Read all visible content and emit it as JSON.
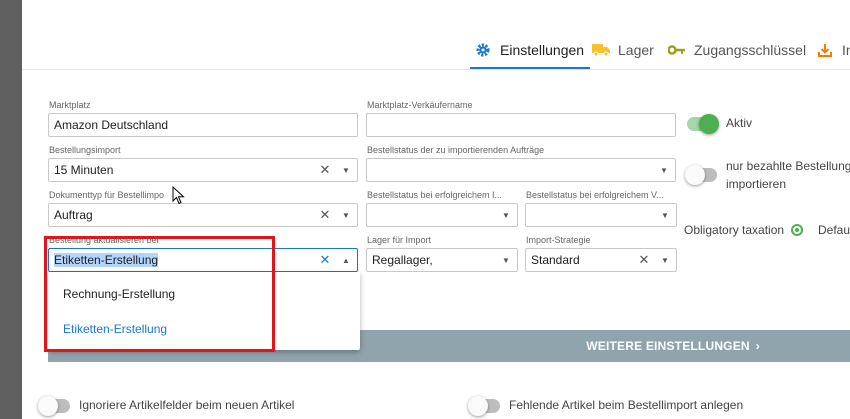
{
  "tabs": [
    {
      "label": "Einstellungen",
      "icon": "gear-icon",
      "color": "#1976d2"
    },
    {
      "label": "Lager",
      "icon": "truck-icon",
      "color": "#fbc02d"
    },
    {
      "label": "Zugangsschlüssel",
      "icon": "key-icon",
      "color": "#9e9d24"
    },
    {
      "label": "In",
      "icon": "download-icon",
      "color": "#f57c00"
    }
  ],
  "form": {
    "marktplatz": {
      "label": "Marktplatz",
      "value": "Amazon Deutschland"
    },
    "verkaeufername": {
      "label": "Marktplatz-Verkäufername",
      "value": ""
    },
    "aktiv": {
      "label": "Aktiv",
      "on": true
    },
    "bestellungsimport": {
      "label": "Bestellungsimport",
      "value": "15 Minuten"
    },
    "bestellstatus_import": {
      "label": "Bestellstatus der zu importierenden Aufträge",
      "value": ""
    },
    "nur_bezahlte": {
      "label": "nur bezahlte Bestellungen importieren",
      "label_line1": "nur bezahlte Bestellunge",
      "label_line2": "importieren",
      "on": false
    },
    "dokumenttyp": {
      "label": "Dokumenttyp für Bestellimpo",
      "value": "Auftrag"
    },
    "status_erfolg1": {
      "label": "Bestellstatus bei erfolgreichem I...",
      "value": ""
    },
    "status_erfolg2": {
      "label": "Bestellstatus bei erfolgreichem V...",
      "value": ""
    },
    "obligatory_taxation": {
      "label": "Obligatory taxation",
      "option": "Defaul"
    },
    "aktualisieren": {
      "label": "Bestellung aktualisieren bei",
      "value": "Etiketten-Erstellung"
    },
    "lager_import": {
      "label": "Lager für Import",
      "value": "Regallager,"
    },
    "import_strategie": {
      "label": "Import-Strategie",
      "value": "Standard"
    }
  },
  "dropdown_options": [
    "Rechnung-Erstellung",
    "Etiketten-Erstellung"
  ],
  "more_button": "WEITERE EINSTELLUNGEN",
  "bottom_toggles": [
    {
      "label": "Ignoriere Artikelfelder beim neuen Artikel",
      "on": false
    },
    {
      "label": "Fehlende Artikel beim Bestellimport anlegen",
      "on": false
    }
  ],
  "colors": {
    "accent": "#1976d2",
    "toggle_on": "#4caf50",
    "highlight": "#e0161b",
    "button": "#90a4ae"
  }
}
